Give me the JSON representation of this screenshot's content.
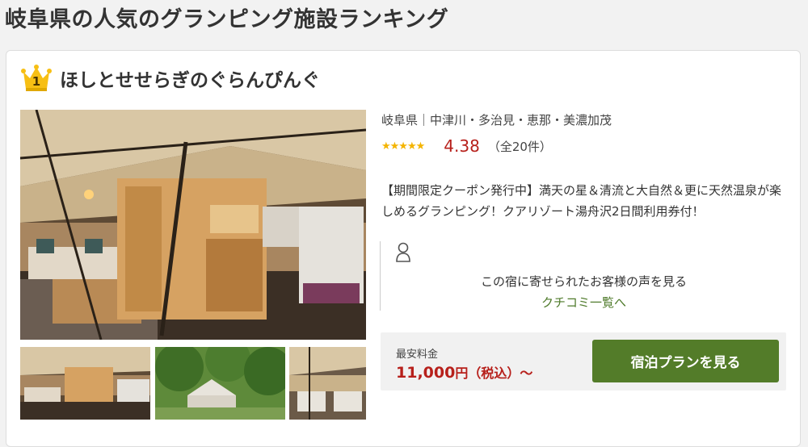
{
  "page": {
    "title": "岐阜県の人気のグランピング施設ランキング"
  },
  "listing": {
    "rank": "1",
    "name": "ほしとせせらぎのぐらんぴんぐ",
    "area": "岐阜県｜中津川・多治見・恵那・美濃加茂",
    "stars": "★★★★★",
    "rating": "4.38",
    "review_count": "（全20件）",
    "description": "【期間限定クーポン発行中】満天の星＆清流と大自然＆更に天然温泉が楽しめるグランピング！クアリゾート湯舟沢2日間利用券付！",
    "reviews": {
      "text": "この宿に寄せられたお客様の声を見る",
      "link": "クチコミ一覧へ"
    },
    "price": {
      "label": "最安料金",
      "value": "11,000",
      "suffix": "円（税込）～"
    },
    "plan_button": "宿泊プランを見る"
  },
  "colors": {
    "accent_green": "#537c29",
    "price_red": "#b7201b",
    "star_gold": "#f4b400",
    "link_green": "#4e7a2a"
  },
  "icons": [
    "crown-icon",
    "person-icon"
  ]
}
